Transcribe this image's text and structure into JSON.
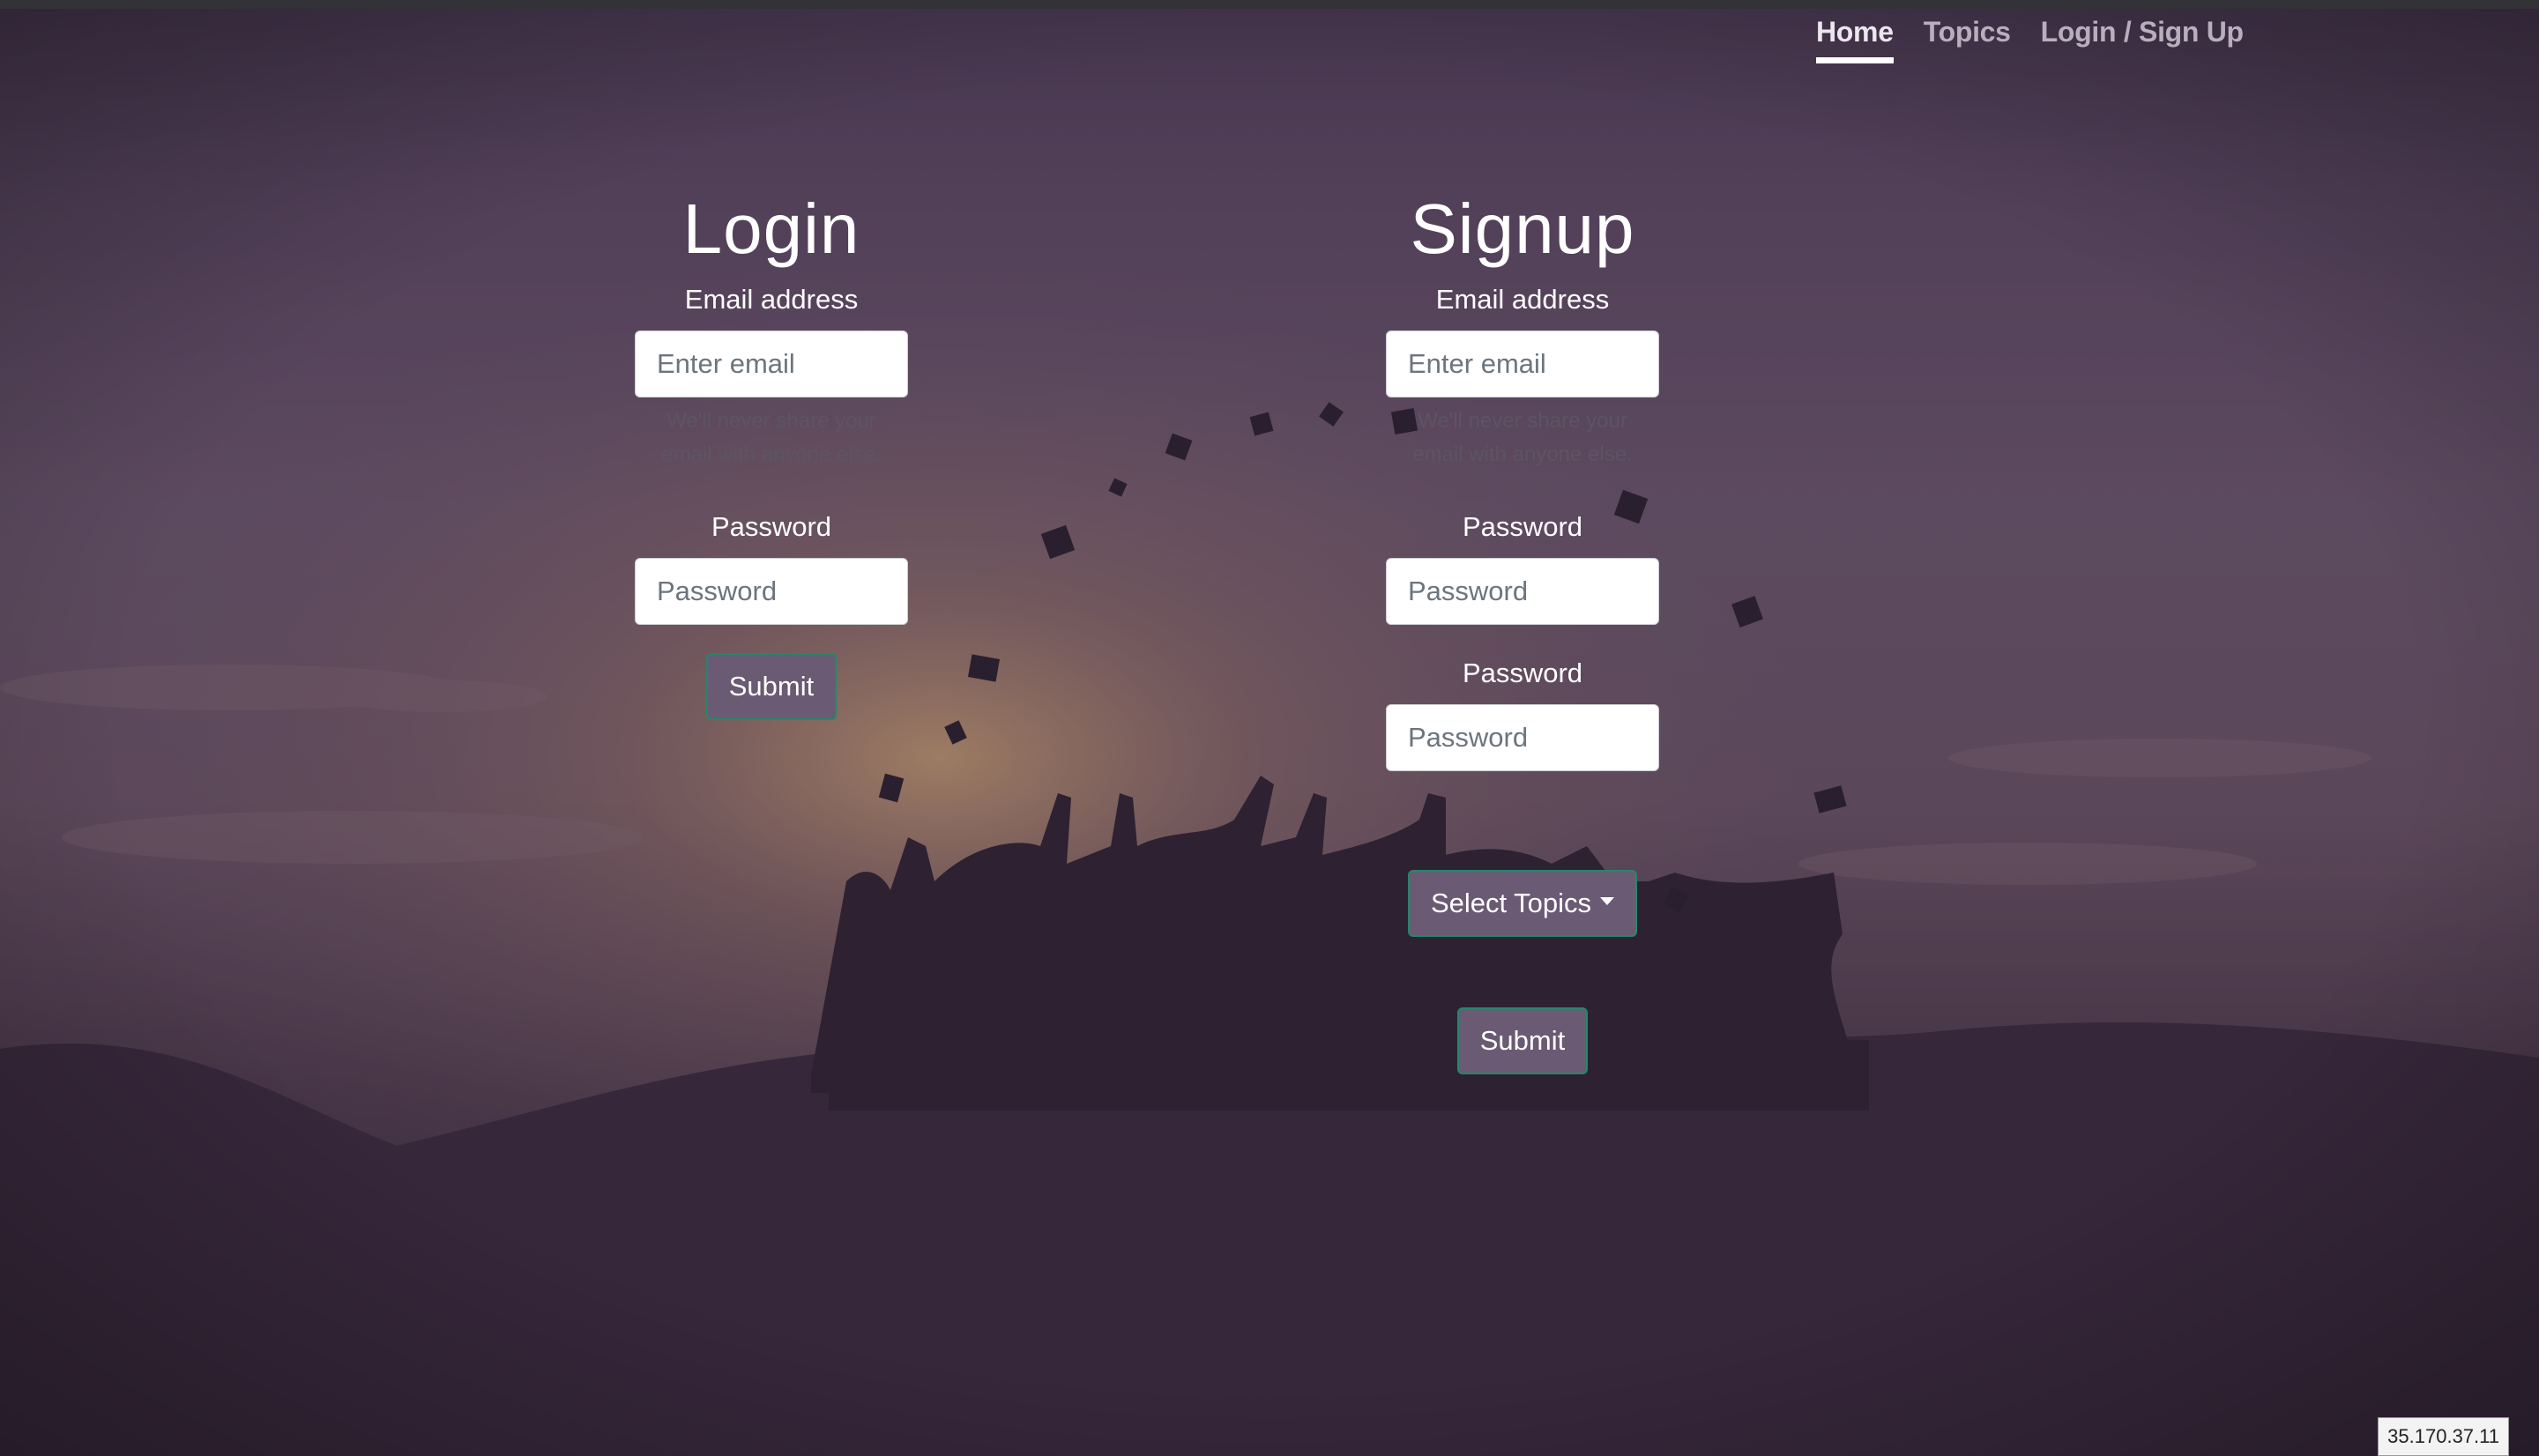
{
  "nav": {
    "items": [
      {
        "label": "Home",
        "active": true
      },
      {
        "label": "Topics",
        "active": false
      },
      {
        "label": "Login / Sign Up",
        "active": false
      }
    ]
  },
  "login": {
    "title": "Login",
    "email_label": "Email address",
    "email_placeholder": "Enter email",
    "email_help": "We'll never share your email with anyone else.",
    "password_label": "Password",
    "password_placeholder": "Password",
    "submit_label": "Submit"
  },
  "signup": {
    "title": "Signup",
    "email_label": "Email address",
    "email_placeholder": "Enter email",
    "email_help": "We'll never share your email with anyone else.",
    "password_label": "Password",
    "password_placeholder": "Password",
    "confirm_label": "Password",
    "confirm_placeholder": "Password",
    "topics_label": "Select Topics",
    "submit_label": "Submit"
  },
  "status": {
    "ip": "35.170.37.11"
  },
  "colors": {
    "accent_button": "#6a5a74",
    "button_border": "#1f8a6a",
    "sky_top": "#6b5670",
    "sky_glow": "#b8926c"
  }
}
